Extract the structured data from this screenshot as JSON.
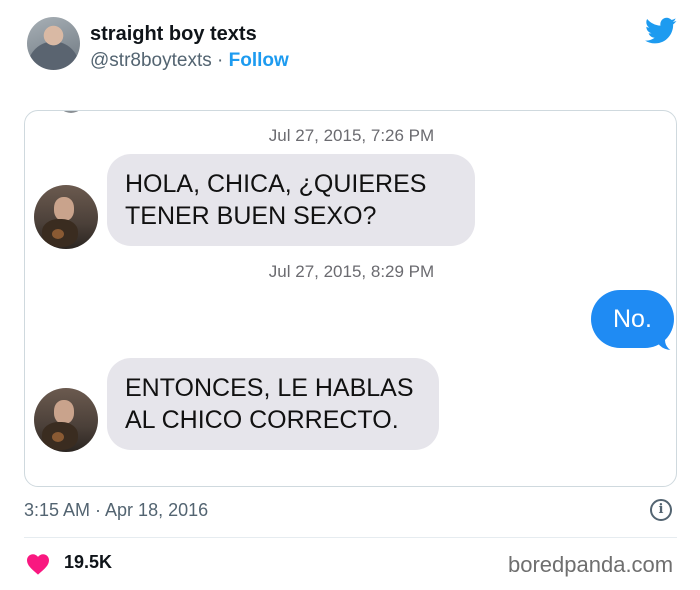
{
  "tweet": {
    "display_name": "straight boy texts",
    "handle": "@str8boytexts",
    "separator": " · ",
    "follow_label": "Follow",
    "timestamp": "3:15 AM · Apr 18, 2016",
    "like_count": "19.5K",
    "watermark": "boredpanda.com",
    "brand_color": "#1d9bf0",
    "like_color": "#f91880"
  },
  "conversation": {
    "timestamp_1": "Jul 27, 2015, 7:26 PM",
    "message_1_line1": "HOLA, CHICA, ¿QUIERES",
    "message_1_line2": "TENER BUEN SEXO?",
    "timestamp_2": "Jul 27, 2015, 8:29 PM",
    "reply": "No.",
    "message_2_line1": "ENTONCES, LE HABLAS",
    "message_2_line2": "AL CHICO CORRECTO.",
    "incoming_bubble_color": "#e6e5eb",
    "outgoing_bubble_color": "#1f8bf3"
  },
  "icons": {
    "brand": "twitter-bird-icon",
    "info": "info-icon",
    "like": "heart-icon"
  }
}
